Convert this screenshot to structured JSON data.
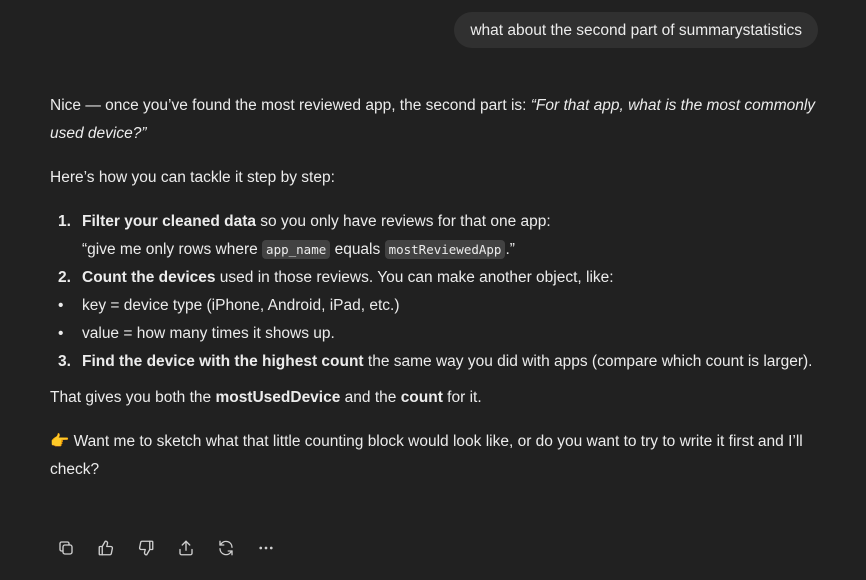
{
  "user_message": "what about the second part of summarystatistics",
  "assistant": {
    "intro_prefix": "Nice — once you’ve found the most reviewed app, the second part is: ",
    "intro_quote": "“For that app, what is the most commonly used device?”",
    "lead": "Here’s how you can tackle it step by step:",
    "steps": [
      {
        "num": "1.",
        "bold": "Filter your cleaned data",
        "rest": " so you only have reviews for that one app:",
        "sub_prefix": "“give me only rows where ",
        "code1": "app_name",
        "sub_mid": " equals ",
        "code2": "mostReviewedApp",
        "sub_suffix": ".”"
      },
      {
        "num": "2.",
        "bold": "Count the devices",
        "rest": " used in those reviews. You can make another object, like:"
      },
      {
        "num": "3.",
        "bold": "Find the device with the highest count",
        "rest": " the same way you did with apps (compare which count is larger)."
      }
    ],
    "bullets": [
      "key = device type (iPhone, Android, iPad, etc.)",
      "value = how many times it shows up."
    ],
    "summary": {
      "prefix": "That gives you both the ",
      "bold1": "mostUsedDevice",
      "mid": " and the ",
      "bold2": "count",
      "suffix": " for it."
    },
    "followup_emoji": "👉",
    "followup": " Want me to sketch what that little counting block would look like, or do you want to try to write it first and I’ll check?"
  },
  "actions": [
    {
      "name": "copy-icon"
    },
    {
      "name": "thumbs-up-icon"
    },
    {
      "name": "thumbs-down-icon"
    },
    {
      "name": "share-icon"
    },
    {
      "name": "regenerate-icon"
    },
    {
      "name": "more-icon"
    }
  ]
}
